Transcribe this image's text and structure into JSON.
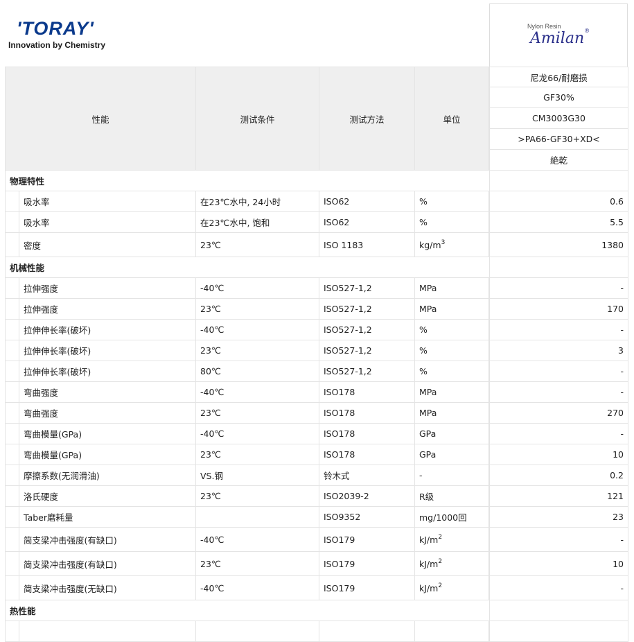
{
  "brand": {
    "name": "'TORAY'",
    "tagline": "Innovation by Chemistry"
  },
  "product": {
    "sub": "Nylon Resin",
    "name": "Amilan",
    "mark": "®"
  },
  "header": {
    "col_property": "性能",
    "col_condition": "测试条件",
    "col_method": "测试方法",
    "col_unit": "单位",
    "value_lines": [
      "尼龙66/耐磨损",
      "GF30%",
      "CM3003G30",
      ">PA66-GF30+XD<",
      "絶乾"
    ]
  },
  "sections": [
    {
      "title": "物理特性",
      "rows": [
        {
          "prop": "吸水率",
          "cond": "在23℃水中, 24小时",
          "method": "ISO62",
          "unit": "%",
          "unit_sup": "",
          "value": "0.6"
        },
        {
          "prop": "吸水率",
          "cond": "在23℃水中, 饱和",
          "method": "ISO62",
          "unit": "%",
          "unit_sup": "",
          "value": "5.5"
        },
        {
          "prop": "密度",
          "cond": "23℃",
          "method": "ISO 1183",
          "unit": "kg/m",
          "unit_sup": "3",
          "value": "1380"
        }
      ]
    },
    {
      "title": "机械性能",
      "rows": [
        {
          "prop": "拉伸强度",
          "cond": "-40℃",
          "method": "ISO527-1,2",
          "unit": "MPa",
          "unit_sup": "",
          "value": "-"
        },
        {
          "prop": "拉伸强度",
          "cond": "23℃",
          "method": "ISO527-1,2",
          "unit": "MPa",
          "unit_sup": "",
          "value": "170"
        },
        {
          "prop": "拉伸伸长率(破坏)",
          "cond": "-40℃",
          "method": "ISO527-1,2",
          "unit": "%",
          "unit_sup": "",
          "value": "-"
        },
        {
          "prop": "拉伸伸长率(破坏)",
          "cond": "23℃",
          "method": "ISO527-1,2",
          "unit": "%",
          "unit_sup": "",
          "value": "3"
        },
        {
          "prop": "拉伸伸长率(破坏)",
          "cond": "80℃",
          "method": "ISO527-1,2",
          "unit": "%",
          "unit_sup": "",
          "value": "-"
        },
        {
          "prop": "弯曲强度",
          "cond": "-40℃",
          "method": "ISO178",
          "unit": "MPa",
          "unit_sup": "",
          "value": "-"
        },
        {
          "prop": "弯曲强度",
          "cond": "23℃",
          "method": "ISO178",
          "unit": "MPa",
          "unit_sup": "",
          "value": "270"
        },
        {
          "prop": "弯曲模量(GPa)",
          "cond": "-40℃",
          "method": "ISO178",
          "unit": "GPa",
          "unit_sup": "",
          "value": "-"
        },
        {
          "prop": "弯曲模量(GPa)",
          "cond": "23℃",
          "method": "ISO178",
          "unit": "GPa",
          "unit_sup": "",
          "value": "10"
        },
        {
          "prop": "摩擦系数(无润滑油)",
          "cond": "VS.钢",
          "method": "铃木式",
          "unit": "-",
          "unit_sup": "",
          "value": "0.2"
        },
        {
          "prop": "洛氏硬度",
          "cond": "23℃",
          "method": "ISO2039-2",
          "unit": "R级",
          "unit_sup": "",
          "value": "121"
        },
        {
          "prop": "Taber磨耗量",
          "cond": "",
          "method": "ISO9352",
          "unit": "mg/1000回",
          "unit_sup": "",
          "value": "23"
        },
        {
          "prop": "简支梁冲击强度(有缺口)",
          "cond": "-40℃",
          "method": "ISO179",
          "unit": "kJ/m",
          "unit_sup": "2",
          "value": "-"
        },
        {
          "prop": "简支梁冲击强度(有缺口)",
          "cond": "23℃",
          "method": "ISO179",
          "unit": "kJ/m",
          "unit_sup": "2",
          "value": "10"
        },
        {
          "prop": "简支梁冲击强度(无缺口)",
          "cond": "-40℃",
          "method": "ISO179",
          "unit": "kJ/m",
          "unit_sup": "2",
          "value": "-"
        }
      ]
    },
    {
      "title": "热性能",
      "rows": []
    }
  ]
}
